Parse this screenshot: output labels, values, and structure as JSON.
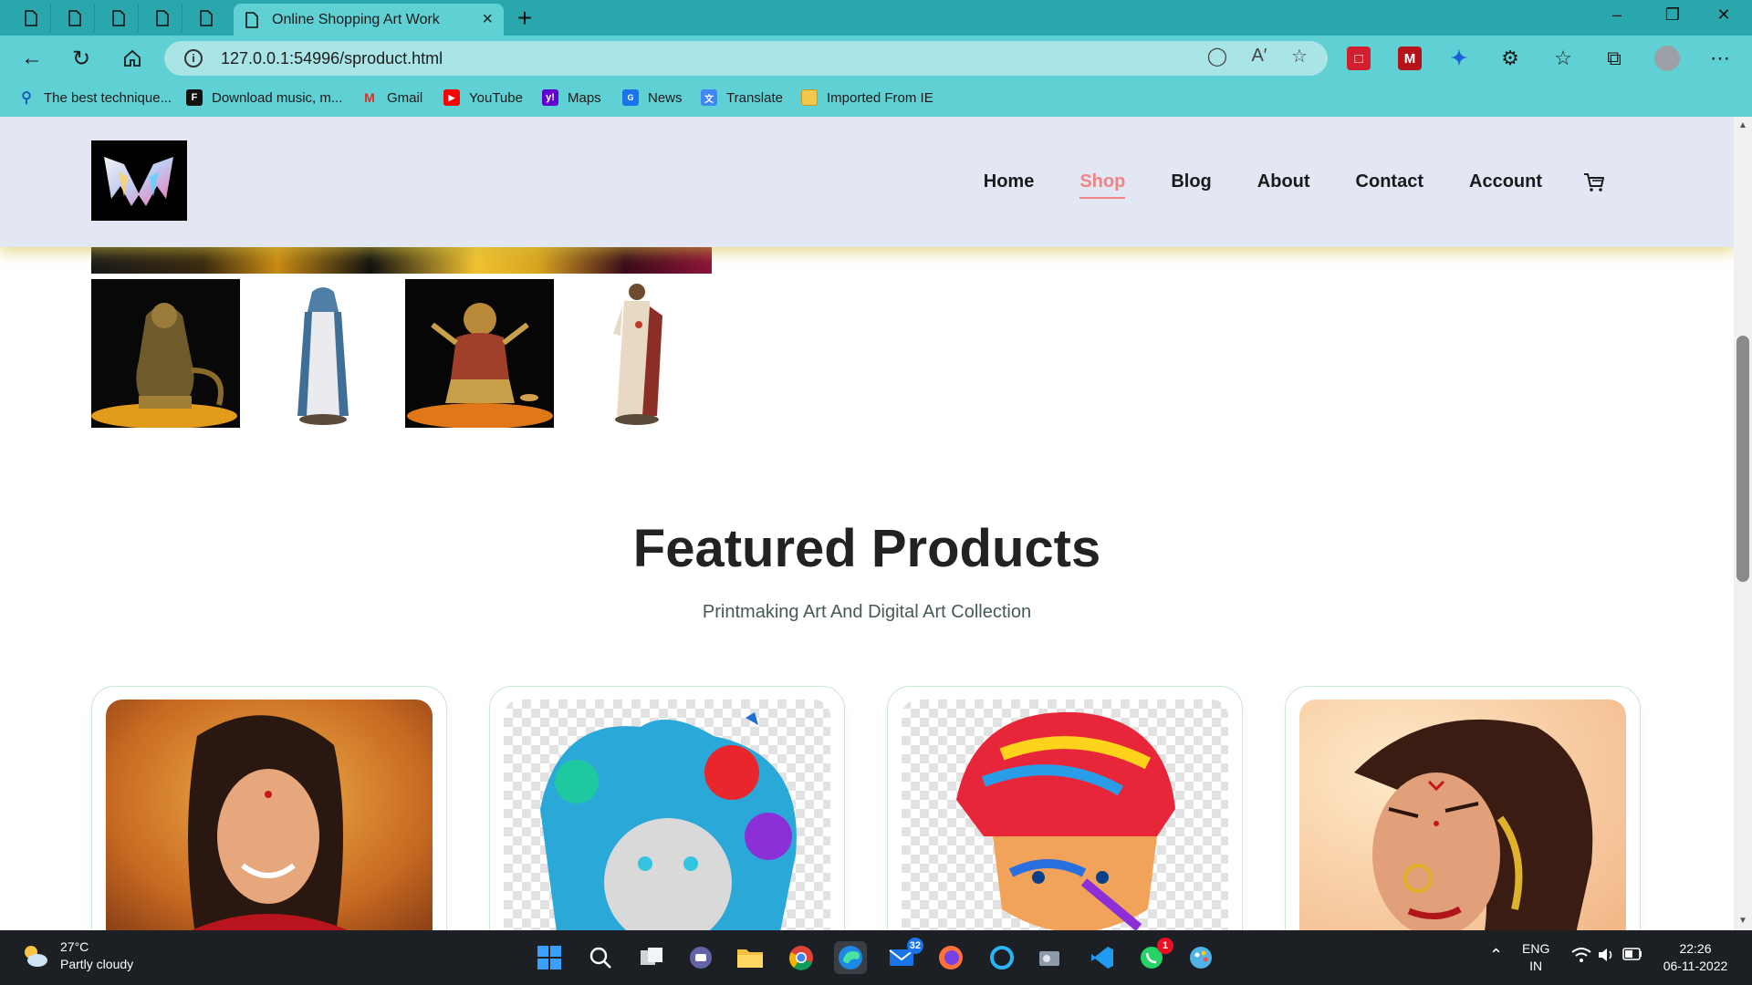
{
  "browser": {
    "tab_title": "Online Shopping Art Work",
    "tab_close": "×",
    "new_tab": "+",
    "url": "127.0.0.1:54996/sproduct.html",
    "window_controls": [
      "–",
      "❐",
      "✕"
    ],
    "bookmarks": [
      {
        "label": "The best technique...",
        "icon": "search-icon",
        "color": "#1a5fb4"
      },
      {
        "label": "Download music, m...",
        "icon": "f-logo-icon",
        "color": "#111111"
      },
      {
        "label": "Gmail",
        "icon": "gmail-icon",
        "color": "#d93025"
      },
      {
        "label": "YouTube",
        "icon": "youtube-icon",
        "color": "#ff0000"
      },
      {
        "label": "Maps",
        "icon": "yahoo-icon",
        "color": "#6001d2"
      },
      {
        "label": "News",
        "icon": "news-icon",
        "color": "#1a73e8"
      },
      {
        "label": "Translate",
        "icon": "translate-icon",
        "color": "#4285f4"
      },
      {
        "label": "Imported From IE",
        "icon": "folder-icon",
        "color": "#e8b130"
      }
    ]
  },
  "site": {
    "nav": [
      "Home",
      "Shop",
      "Blog",
      "About",
      "Contact",
      "Account"
    ],
    "active_nav": "Shop",
    "accent_color": "#f08585",
    "header_bg": "#e3e6f3"
  },
  "featured": {
    "title": "Featured Products",
    "subtitle": "Printmaking Art And Digital Art Collection"
  },
  "taskbar": {
    "weather_temp": "27°C",
    "weather_desc": "Partly cloudy",
    "mail_badge": "32",
    "whatsapp_badge": "1",
    "lang_top": "ENG",
    "lang_bottom": "IN",
    "time": "22:26",
    "date": "06-11-2022"
  }
}
